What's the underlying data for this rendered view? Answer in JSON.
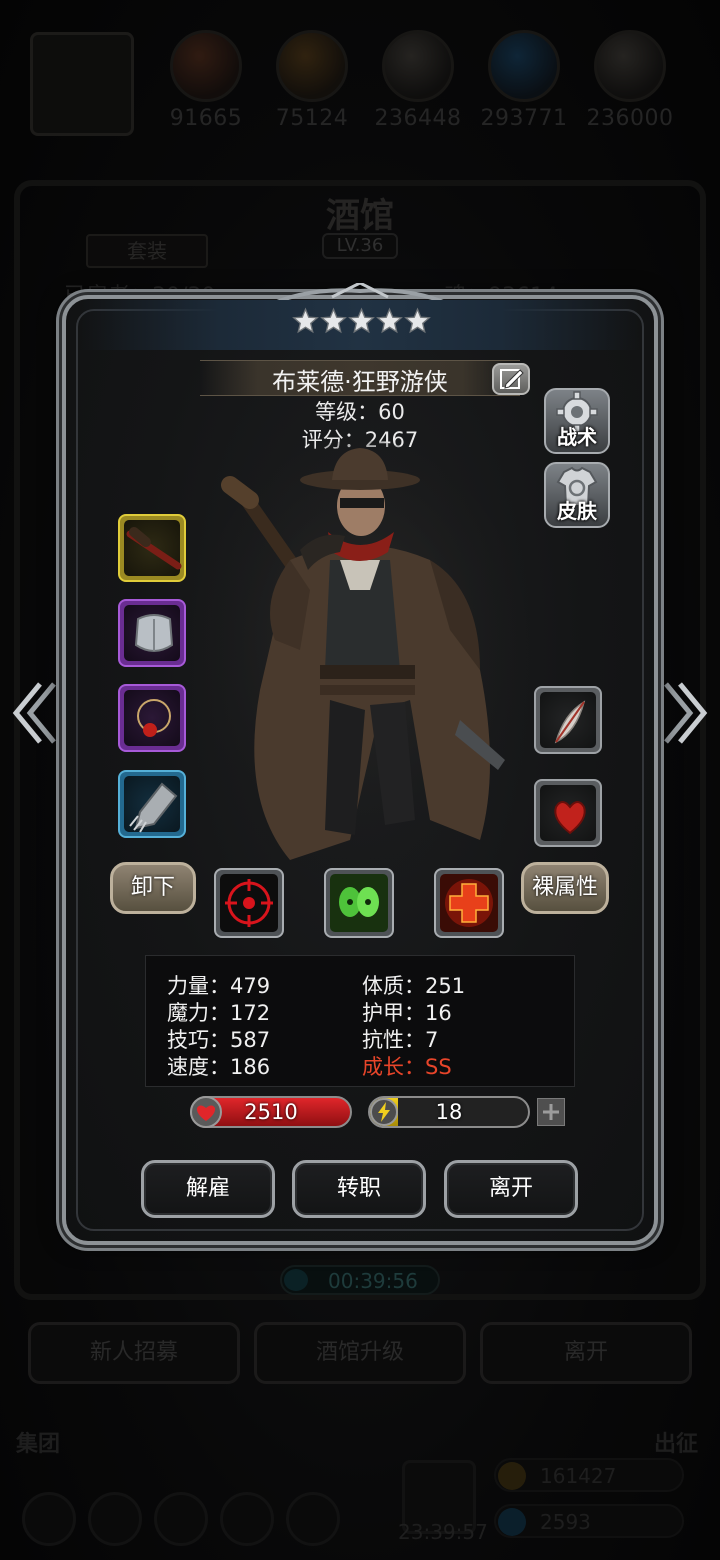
{
  "resources": [
    {
      "icon": "red-orb-icon",
      "value": "91665"
    },
    {
      "icon": "orange-orb-icon",
      "value": "75124"
    },
    {
      "icon": "grey-orb-icon",
      "value": "236448"
    },
    {
      "icon": "blue-orb-icon",
      "value": "293771"
    },
    {
      "icon": "white-orb-icon",
      "value": "236000"
    }
  ],
  "tavern": {
    "title": "酒馆",
    "level": "LV.36",
    "tab_set": "套装",
    "recruits_text": "已雇者：30/30",
    "soul_text": "魂：93614",
    "timer": "00:39:56",
    "buttons": {
      "recruit": "新人招募",
      "upgrade": "酒馆升级",
      "leave": "离开"
    }
  },
  "footer": {
    "left_label": "集团",
    "right_label": "出征",
    "gift_timer": "23:39:57",
    "gold": "161427",
    "gems": "2593"
  },
  "hero": {
    "stars": 5,
    "name": "布莱德·狂野游侠",
    "level": "等级：60",
    "score": "评分：2467",
    "tactics_label": "战术",
    "skin_label": "皮肤",
    "unequip_label": "卸下",
    "base_stats_label": "裸属性",
    "stats": {
      "strength": "力量：479",
      "magic": "魔力：172",
      "skill": "技巧：587",
      "speed": "速度：186",
      "constitution": "体质：251",
      "armor": "护甲：16",
      "resistance": "抗性：7",
      "growth": "成长：SS"
    },
    "hp": "2510",
    "energy": "18",
    "energy_fraction": 0.18,
    "equipment_left": [
      {
        "name": "rifle-icon",
        "rarity": "gold"
      },
      {
        "name": "chest-armor-icon",
        "rarity": "purple"
      },
      {
        "name": "amulet-icon",
        "rarity": "purple"
      },
      {
        "name": "gauntlet-icon",
        "rarity": "blue"
      }
    ],
    "equipment_right": [
      {
        "name": "feather-icon",
        "rarity": "grey"
      },
      {
        "name": "heart-gem-icon",
        "rarity": "grey"
      }
    ],
    "skills": [
      {
        "name": "crosshair-skill-icon",
        "color": "#d8141c"
      },
      {
        "name": "twin-skull-skill-icon",
        "color": "#4ec23a"
      },
      {
        "name": "red-cross-skill-icon",
        "color": "#e8401a"
      }
    ]
  },
  "actions": {
    "dismiss": "解雇",
    "change_class": "转职",
    "leave": "离开"
  },
  "colors": {
    "growth": "#e8452a",
    "hp": "#e0262a",
    "energy": "#f0cf1e"
  }
}
